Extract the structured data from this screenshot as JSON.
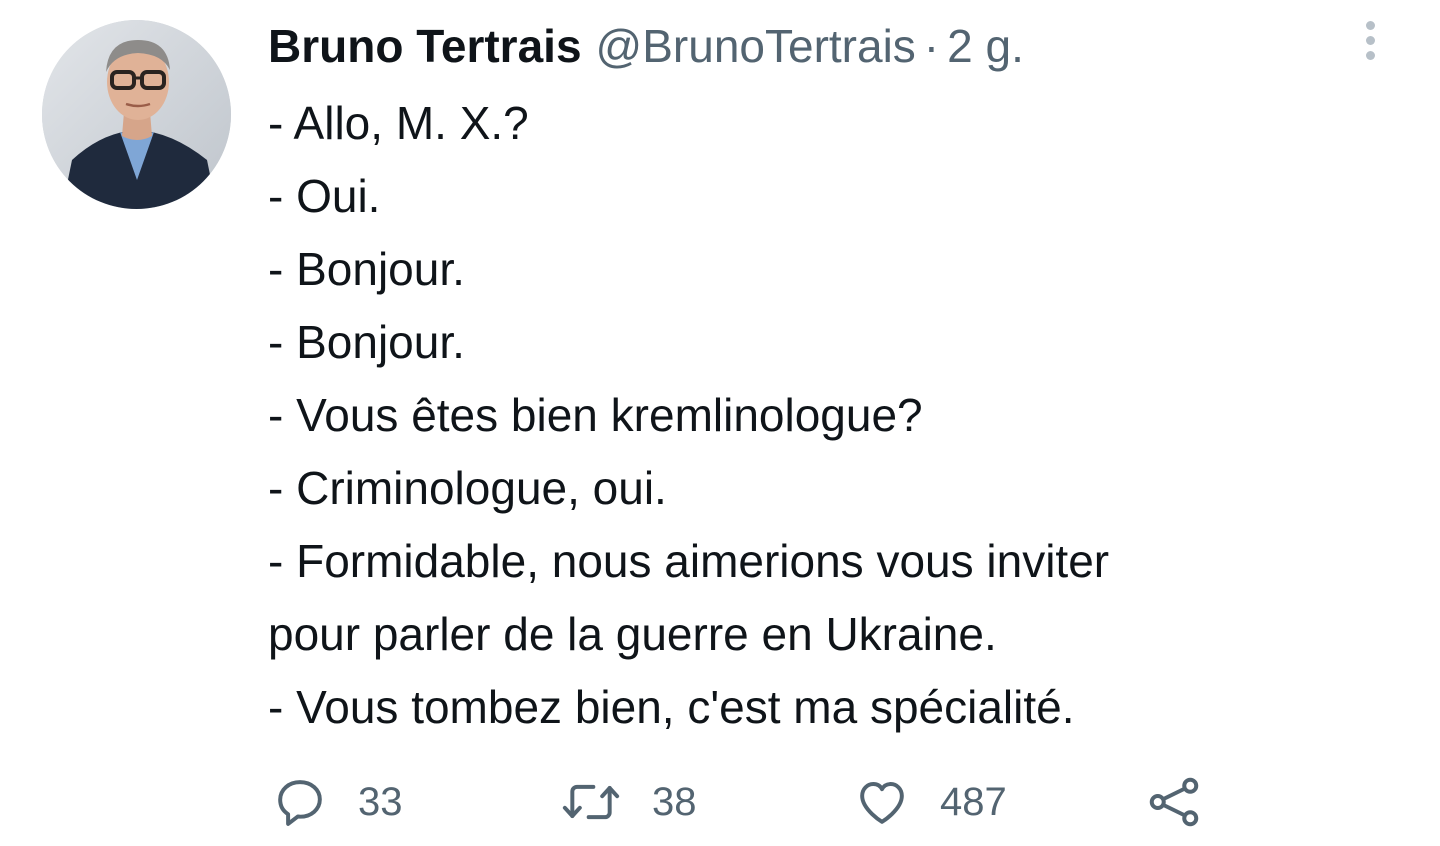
{
  "tweet": {
    "author": {
      "name": "Bruno Tertrais",
      "handle": "@BrunoTertrais",
      "separator": "·",
      "time": "2 g.",
      "avatar_icon": "profile-photo"
    },
    "lines": [
      "- Allo, M. X.?",
      "- Oui.",
      "- Bonjour.",
      "- Bonjour.",
      "- Vous êtes bien kremlinologue?",
      "- Criminologue, oui.",
      "- Formidable, nous aimerions vous inviter",
      "pour parler de la guerre en Ukraine.",
      "- Vous tombez bien, c'est ma spécialité."
    ],
    "actions": {
      "replies": "33",
      "retweets": "38",
      "likes": "487",
      "icons": [
        "reply-icon",
        "retweet-icon",
        "like-icon",
        "share-icon"
      ]
    },
    "more_icon": "more-options-icon"
  },
  "colors": {
    "text": "#0f1419",
    "secondary": "#536471",
    "icon": "#536471",
    "dots": "#b7c0c8"
  }
}
